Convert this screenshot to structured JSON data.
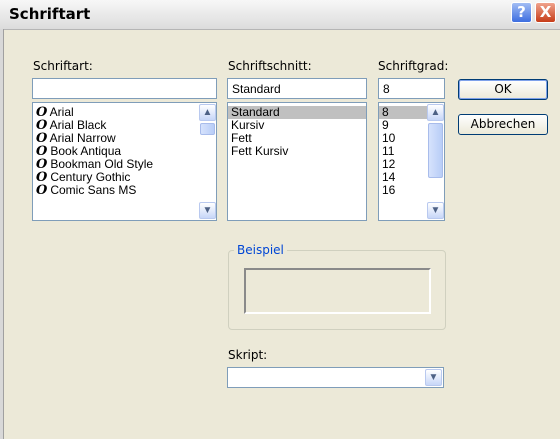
{
  "window": {
    "title": "Schriftart",
    "help_glyph": "?",
    "close_glyph": "X"
  },
  "font": {
    "label": "Schriftart:",
    "value": "",
    "items": [
      "Arial",
      "Arial Black",
      "Arial Narrow",
      "Book Antiqua",
      "Bookman Old Style",
      "Century Gothic",
      "Comic Sans MS"
    ],
    "font_glyph": "O"
  },
  "style": {
    "label": "Schriftschnitt:",
    "value": "Standard",
    "items": [
      "Standard",
      "Kursiv",
      "Fett",
      "Fett Kursiv"
    ],
    "selected_index": 0
  },
  "size": {
    "label": "Schriftgrad:",
    "value": "8",
    "items": [
      "8",
      "9",
      "10",
      "11",
      "12",
      "14",
      "16"
    ],
    "selected_index": 0
  },
  "buttons": {
    "ok": "OK",
    "cancel": "Abbrechen"
  },
  "sample": {
    "group_label": "Beispiel"
  },
  "script": {
    "label": "Skript:",
    "value": ""
  },
  "colors": {
    "accent_blue": "#0046d5",
    "close_red": "#c63c19",
    "selection_gray": "#c0c0c0"
  }
}
